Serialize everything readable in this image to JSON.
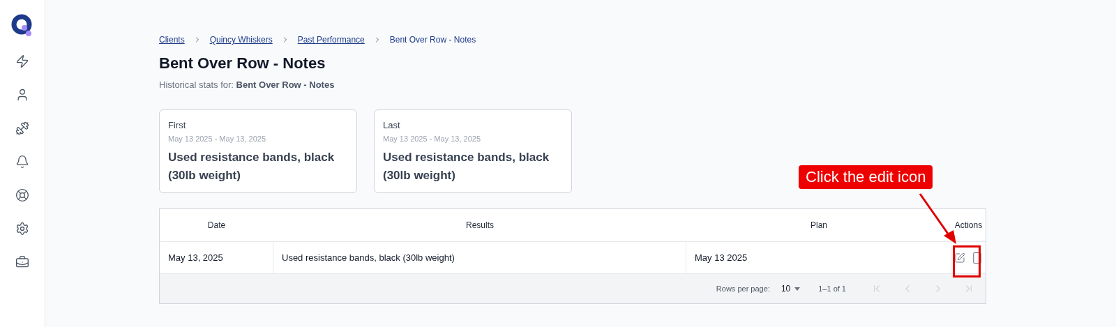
{
  "sidebar": {
    "items": [
      {
        "kind": "zap",
        "selected": false
      },
      {
        "kind": "user",
        "selected": false
      },
      {
        "kind": "dumbbell",
        "selected": false
      },
      {
        "kind": "bell",
        "selected": false
      },
      {
        "kind": "lifebuoy",
        "selected": false
      },
      {
        "kind": "settings",
        "selected": false
      },
      {
        "kind": "toolbox",
        "selected": false
      }
    ]
  },
  "breadcrumbs": [
    {
      "label": "Clients",
      "link": true
    },
    {
      "label": "Quincy Whiskers",
      "link": true
    },
    {
      "label": "Past Performance",
      "link": true
    },
    {
      "label": "Bent Over Row - Notes",
      "link": false
    }
  ],
  "title": "Bent Over Row - Notes",
  "subtitle": "Historical stats for: **Bent Over Row - Notes**",
  "cards": [
    {
      "label": "First",
      "range": "May 13 2025 - May 13, 2025",
      "value": "Used resistance bands, black (30lb weight)"
    },
    {
      "label": "Last",
      "range": "May 13 2025 - May 13, 2025",
      "value": "Used resistance bands, black (30lb weight)"
    }
  ],
  "table": {
    "columns": [
      "Date",
      "Results",
      "Plan",
      "Actions"
    ],
    "rows": [
      {
        "cells": [
          "May 13, 2025",
          "Used resistance bands, black (30lb weight)",
          "May 13 2025"
        ]
      }
    ],
    "footer": {
      "rows_per_page_label": "Rows per page:",
      "rows_per_page": "10",
      "range": "1–1 of 1",
      "pager": [
        {
          "kind": "first",
          "disabled": true
        },
        {
          "kind": "prev",
          "disabled": true
        },
        {
          "kind": "next",
          "disabled": true
        },
        {
          "kind": "last",
          "disabled": true
        }
      ]
    }
  },
  "annotation": {
    "text": "Click the edit icon"
  }
}
